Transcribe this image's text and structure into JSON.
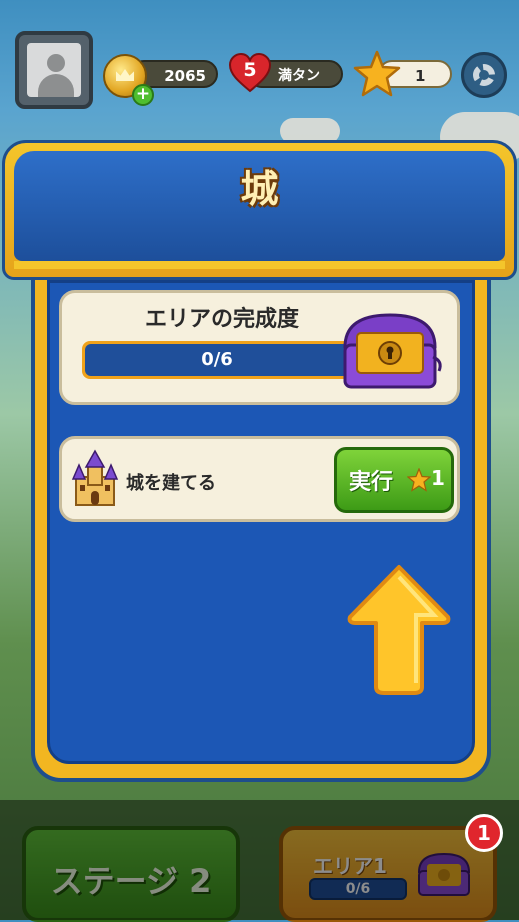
{
  "topbar": {
    "coins": "2065",
    "lives": "5",
    "lives_status": "満タン",
    "stars": "1"
  },
  "panel": {
    "title": "城",
    "progress_card": {
      "title": "エリアの完成度",
      "progress_text": "0/6",
      "progress_value": 0,
      "progress_total": 6
    },
    "task": {
      "label": "城を建てる",
      "button_label": "実行",
      "star_cost": "1"
    }
  },
  "bottom": {
    "stage_button": "ステージ 2",
    "area_label": "エリア1",
    "area_progress": "0/6",
    "area_badge": "1"
  },
  "colors": {
    "panel_blue": "#1c57b5",
    "gold": "#f2b621",
    "green_button": "#4fb52a",
    "badge_red": "#e0262d"
  }
}
